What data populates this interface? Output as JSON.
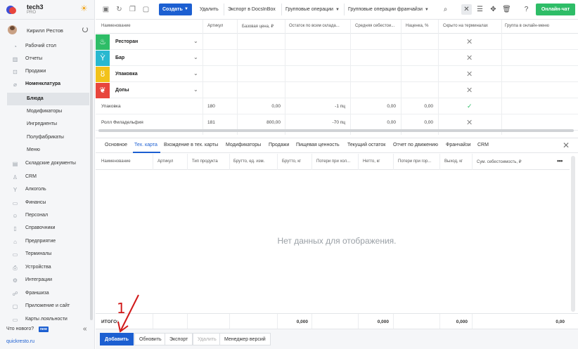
{
  "brand": {
    "name": "tech3",
    "plan": "PRO"
  },
  "user": {
    "name": "Кирилл Рестов"
  },
  "sidebar": {
    "items": [
      {
        "label": "Рабочий стол",
        "icon": "speedometer-icon"
      },
      {
        "label": "Отчеты",
        "icon": "chart-icon"
      },
      {
        "label": "Продажи",
        "icon": "cart-icon"
      },
      {
        "label": "Номенклатура",
        "icon": "tag-icon"
      },
      {
        "label": "Блюда",
        "icon": ""
      },
      {
        "label": "Модификаторы",
        "icon": ""
      },
      {
        "label": "Ингредиенты",
        "icon": ""
      },
      {
        "label": "Полуфабрикаты",
        "icon": ""
      },
      {
        "label": "Меню",
        "icon": ""
      },
      {
        "label": "Складские документы",
        "icon": "document-icon"
      },
      {
        "label": "CRM",
        "icon": "crm-icon"
      },
      {
        "label": "Алкоголь",
        "icon": "glass-icon"
      },
      {
        "label": "Финансы",
        "icon": "wallet-icon"
      },
      {
        "label": "Персонал",
        "icon": "person-icon"
      },
      {
        "label": "Справочники",
        "icon": "book-icon"
      },
      {
        "label": "Предприятие",
        "icon": "building-icon"
      },
      {
        "label": "Терминалы",
        "icon": "monitor-icon"
      },
      {
        "label": "Устройства",
        "icon": "printer-icon"
      },
      {
        "label": "Интеграции",
        "icon": "plug-icon"
      },
      {
        "label": "Франшиза",
        "icon": "franchise-icon"
      },
      {
        "label": "Приложение и сайт",
        "icon": "app-icon"
      },
      {
        "label": "Карты лояльности",
        "icon": "card-icon"
      }
    ],
    "whats_new": "Что нового?",
    "new_badge": "new",
    "footer_link": "quickresto.ru"
  },
  "toolbar": {
    "create": "Создать",
    "delete": "Удалить",
    "export_docsinbox": "Экспорт в DocsInBox",
    "group_ops": "Групповые операции",
    "group_ops_franchise": "Групповые операции франчайзи",
    "chat": "Онлайн-чат"
  },
  "grid": {
    "columns": [
      "Наименование",
      "Артикул",
      "Базовая цена, ₽",
      "Остаток по всем склада...",
      "Средняя себестои...",
      "Наценка, %",
      "Скрыто на терминалах",
      "Группа в онлайн-меню"
    ],
    "categories": [
      {
        "name": "Ресторан",
        "color": "#2ebd67"
      },
      {
        "name": "Бар",
        "color": "#29b8d0"
      },
      {
        "name": "Упаковка",
        "color": "#f2c21a"
      },
      {
        "name": "Допы",
        "color": "#e8453c"
      }
    ],
    "rows": [
      {
        "name": "Упаковка",
        "sku": "180",
        "price": "0,00",
        "stock": "-1 пц",
        "cost": "0,00",
        "markup": "0,00"
      },
      {
        "name": "Ролл Филадельфия",
        "sku": "181",
        "price": "800,00",
        "stock": "-70 пц",
        "cost": "0,00",
        "markup": "0,00"
      }
    ]
  },
  "tabs": [
    "Основное",
    "Тех. карта",
    "Вхождение в тех. карты",
    "Модификаторы",
    "Продажи",
    "Пищевая ценность",
    "Текущий остаток",
    "Отчет по движению",
    "Франчайзи",
    "CRM"
  ],
  "detail": {
    "columns": [
      "Наименование",
      "Артикул",
      "Тип продукта",
      "Брутто, ед. изм.",
      "Брутто, кг",
      "Потери при хол...",
      "Нетто, кг",
      "Потери при гор...",
      "Выход, кг",
      "Сум. себестоимость, ₽"
    ],
    "empty": "Нет данных для отображения.",
    "totals_label": "ИТОГО:",
    "totals": [
      "0,000",
      "0,000",
      "0,000",
      "0,00"
    ]
  },
  "bottom": {
    "add": "Добавить",
    "refresh": "Обновить",
    "export": "Экспорт",
    "delete": "Удалить",
    "versions": "Менеджер версий"
  },
  "annotation": "1"
}
